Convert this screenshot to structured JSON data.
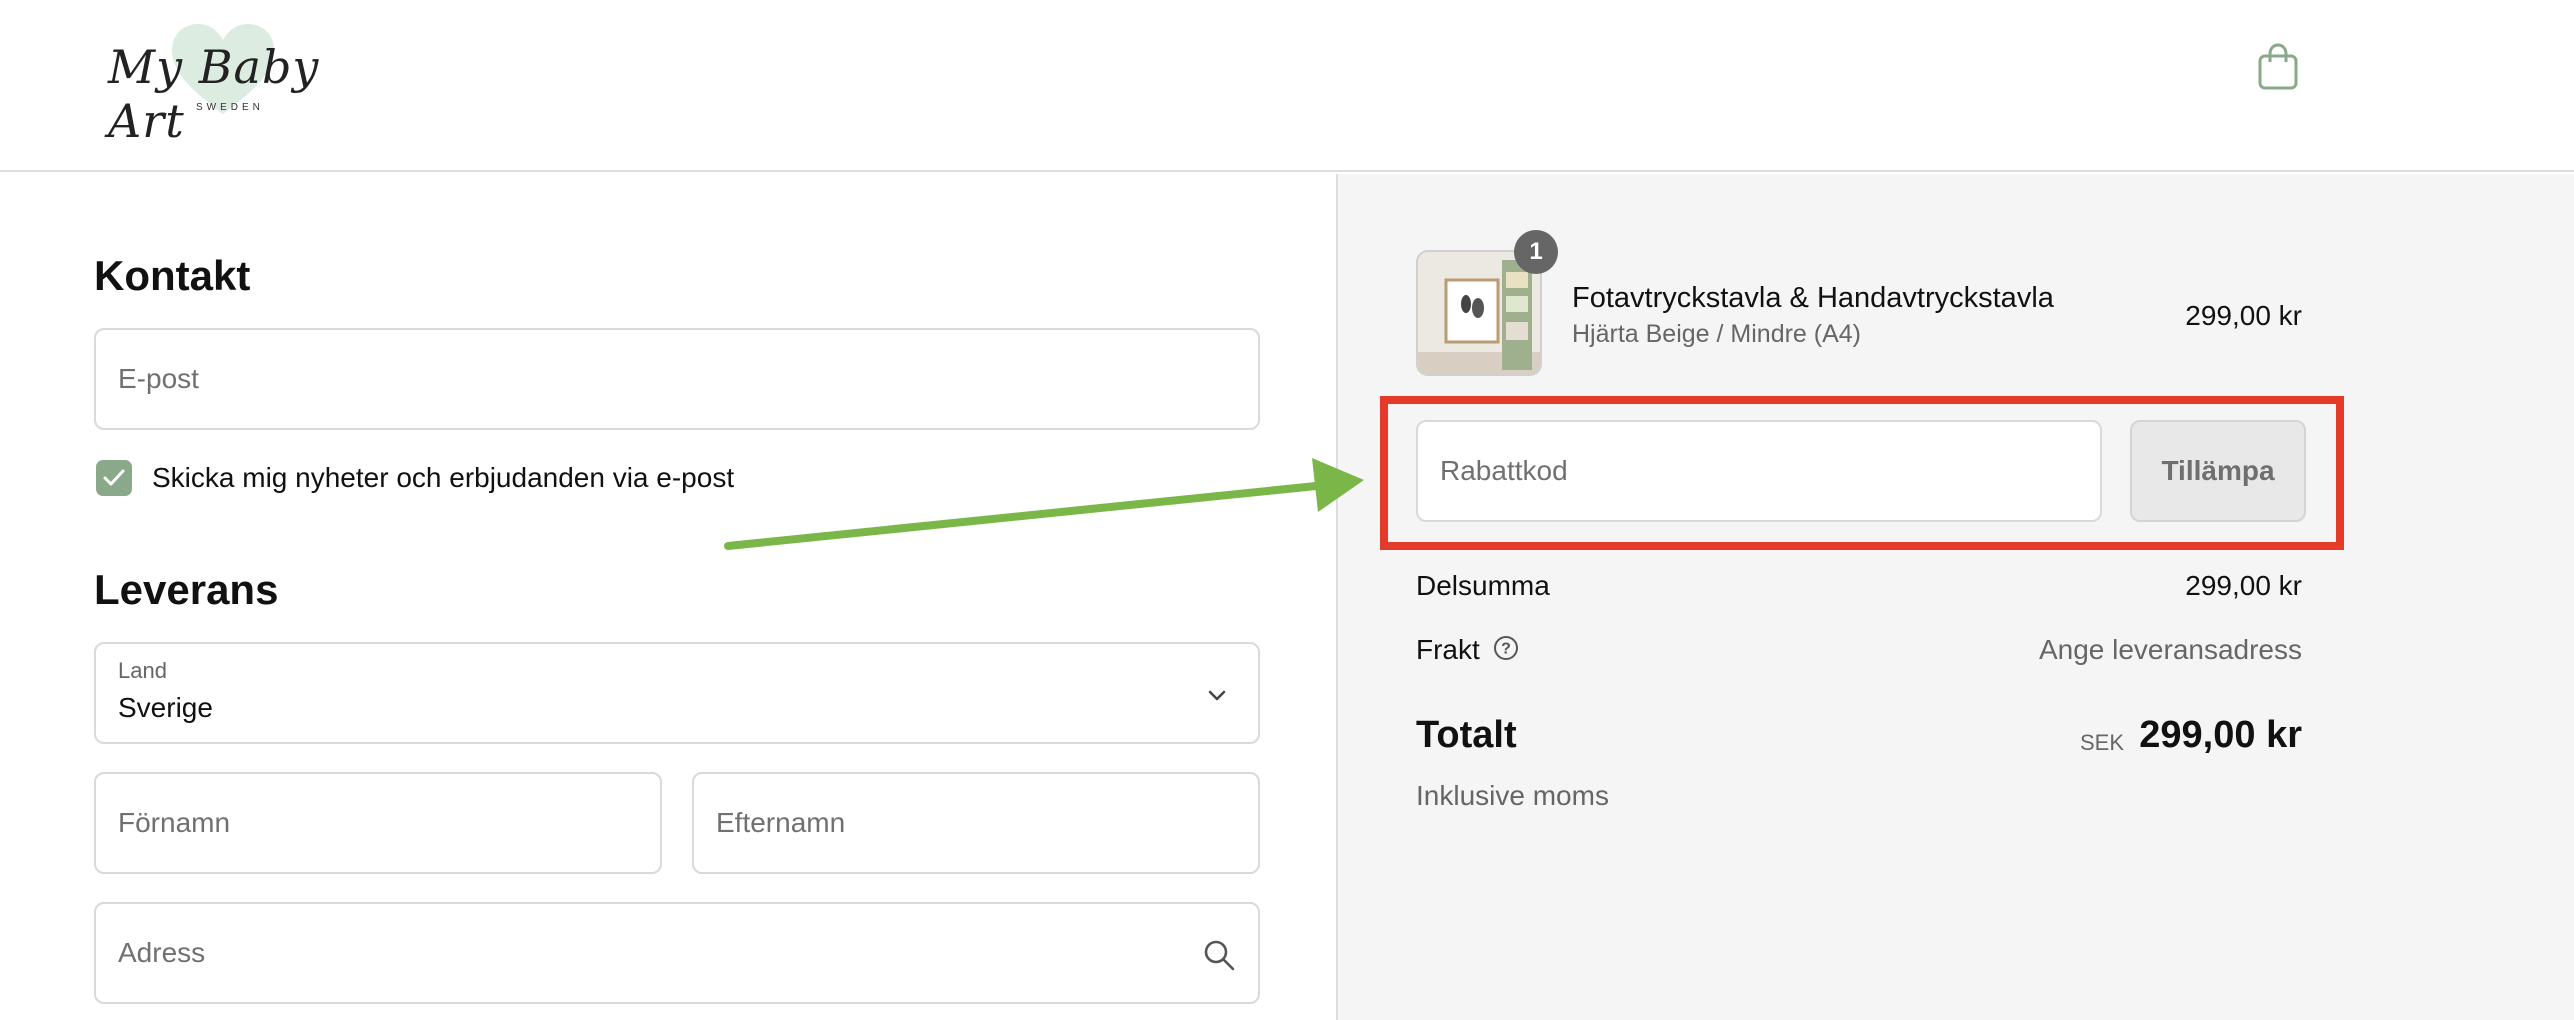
{
  "brand": {
    "logo_text": "My Baby Art",
    "logo_sub": "SWEDEN",
    "accent": "#8aa98a"
  },
  "header": {
    "cart_icon": "shopping-bag-icon"
  },
  "contact": {
    "heading": "Kontakt",
    "email_placeholder": "E-post",
    "newsletter_checked": true,
    "newsletter_label": "Skicka mig nyheter och erbjudanden via e-post"
  },
  "delivery": {
    "heading": "Leverans",
    "country_label": "Land",
    "country_value": "Sverige",
    "first_name_placeholder": "Förnamn",
    "last_name_placeholder": "Efternamn",
    "address_placeholder": "Adress"
  },
  "summary": {
    "item": {
      "quantity": "1",
      "title": "Fotavtryckstavla & Handavtryckstavla",
      "variant": "Hjärta Beige / Mindre (A4)",
      "price": "299,00 kr"
    },
    "discount_placeholder": "Rabattkod",
    "apply_label": "Tillämpa",
    "subtotal_label": "Delsumma",
    "subtotal_value": "299,00 kr",
    "shipping_label": "Frakt",
    "shipping_value": "Ange leveransadress",
    "total_label": "Totalt",
    "currency": "SEK",
    "total_value": "299,00 kr",
    "tax_note": "Inklusive moms"
  },
  "annotation_colors": {
    "highlight_box": "#e53a2a",
    "arrow": "#7ab648"
  }
}
